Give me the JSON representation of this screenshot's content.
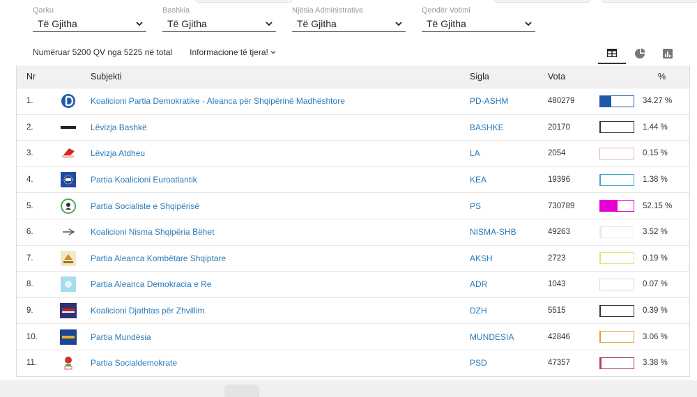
{
  "filters": [
    {
      "label": "Qarku",
      "value": "Të Gjitha"
    },
    {
      "label": "Bashkia",
      "value": "Të Gjitha"
    },
    {
      "label": "Njësia Administrative",
      "value": "Të Gjitha"
    },
    {
      "label": "Qendër Votimi",
      "value": "Të Gjitha"
    }
  ],
  "info": {
    "counted": "Numëruar 5200 QV nga 5225 në total",
    "more": "Informacione të tjera!"
  },
  "table": {
    "headers": {
      "nr": "Nr",
      "subject": "Subjekti",
      "sigla": "Sigla",
      "vota": "Vota",
      "pct": "%"
    },
    "rows": [
      {
        "nr": "1.",
        "subject": "Koalicioni Partia Demokratike - Aleanca për Shqipërinë Madhështore",
        "sigla": "PD-ASHM",
        "vota": "480279",
        "pct": "34.27 %",
        "share": 34.27,
        "color": "#1e5aa8",
        "logo": "pd-logo-icon"
      },
      {
        "nr": "2.",
        "subject": "Lëvizja Bashkë",
        "sigla": "BASHKE",
        "vota": "20170",
        "pct": "1.44 %",
        "share": 1.44,
        "color": "#333333",
        "logo": "bashke-logo-icon"
      },
      {
        "nr": "3.",
        "subject": "Lëvizja Atdheu",
        "sigla": "LA",
        "vota": "2054",
        "pct": "0.15 %",
        "share": 0.15,
        "color": "#e6a9c4",
        "logo": "la-logo-icon"
      },
      {
        "nr": "4.",
        "subject": "Partia Koalicioni Euroatlantik",
        "sigla": "KEA",
        "vota": "19396",
        "pct": "1.38 %",
        "share": 1.38,
        "color": "#3aa8c9",
        "logo": "kea-logo-icon"
      },
      {
        "nr": "5.",
        "subject": "Partia Socialiste e Shqipërisë",
        "sigla": "PS",
        "vota": "730789",
        "pct": "52.15 %",
        "share": 52.15,
        "color": "#e600d4",
        "logo": "ps-logo-icon"
      },
      {
        "nr": "6.",
        "subject": "Koalicioni Nisma Shqipëria Bëhet",
        "sigla": "NISMA-SHB",
        "vota": "49263",
        "pct": "3.52 %",
        "share": 3.52,
        "color": "#e8e8e8",
        "logo": "nisma-logo-icon"
      },
      {
        "nr": "7.",
        "subject": "Partia Aleanca Kombëtare Shqiptare",
        "sigla": "AKSH",
        "vota": "2723",
        "pct": "0.19 %",
        "share": 0.19,
        "color": "#e8e07a",
        "logo": "aksh-logo-icon"
      },
      {
        "nr": "8.",
        "subject": "Partia Aleanca Demokracia e Re",
        "sigla": "ADR",
        "vota": "1043",
        "pct": "0.07 %",
        "share": 0.07,
        "color": "#bde4ef",
        "logo": "adr-logo-icon"
      },
      {
        "nr": "9.",
        "subject": "Koalicioni Djathtas për Zhvillim",
        "sigla": "DZH",
        "vota": "5515",
        "pct": "0.39 %",
        "share": 0.39,
        "color": "#333333",
        "logo": "dzh-logo-icon"
      },
      {
        "nr": "10.",
        "subject": "Partia Mundësia",
        "sigla": "MUNDESIA",
        "vota": "42846",
        "pct": "3.06 %",
        "share": 3.06,
        "color": "#e0a030",
        "logo": "mundesia-logo-icon"
      },
      {
        "nr": "11.",
        "subject": "Partia Socialdemokrate",
        "sigla": "PSD",
        "vota": "47357",
        "pct": "3.38 %",
        "share": 3.38,
        "color": "#b04060",
        "logo": "psd-logo-icon"
      }
    ]
  },
  "view_icons": [
    "table-view-icon",
    "pie-view-icon",
    "bar-view-icon"
  ],
  "colors": {
    "link": "#2a7ab8",
    "header_bg": "#f1f1f1"
  }
}
